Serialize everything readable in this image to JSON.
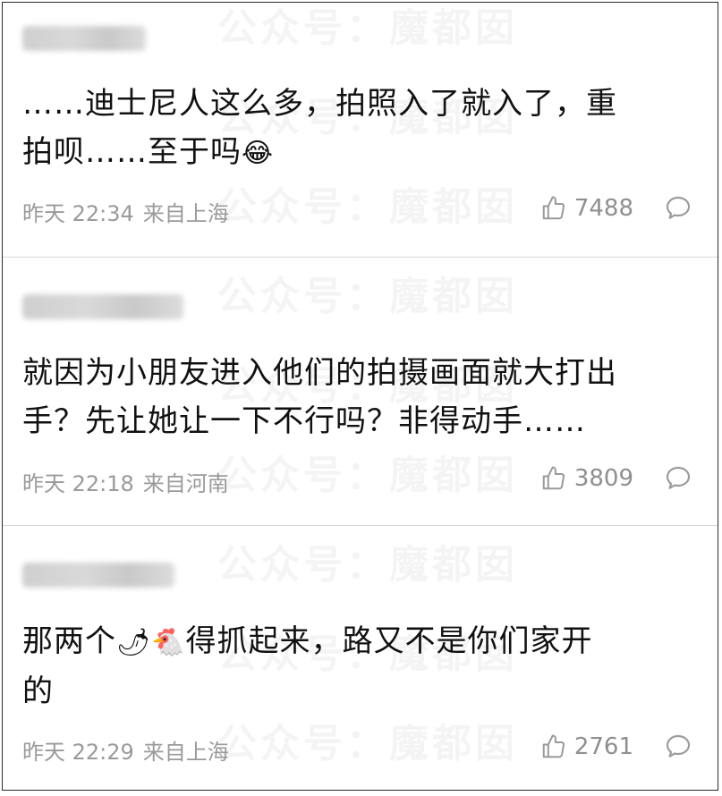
{
  "watermark_text": "公众号：魔都囡",
  "comments": [
    {
      "text_line1": "……迪士尼人这么多，拍照入了就入了，重",
      "text_line2": "拍呗……至于吗",
      "emoji": "😂",
      "time": "昨天 22:34",
      "location": "来自上海",
      "likes": "7488"
    },
    {
      "text_line1": "就因为小朋友进入他们的拍摄画面就大打出",
      "text_line2": "手？先让她让一下不行吗？非得动手……",
      "time": "昨天 22:18",
      "location": "来自河南",
      "likes": "3809"
    },
    {
      "text_before_emoji": "那两个",
      "emoji_chili": "🌶",
      "emoji_chicken": "🐔",
      "text_after_emoji": "得抓起来，路又不是你们家开",
      "text_line2": "的",
      "time": "昨天 22:29",
      "location": "来自上海",
      "likes": "2761"
    }
  ],
  "icons": {
    "like": "thumbs-up-icon",
    "comment": "comment-bubble-icon"
  },
  "colors": {
    "text": "#111111",
    "meta": "#9a9a9a",
    "divider": "#d6d6d6"
  }
}
